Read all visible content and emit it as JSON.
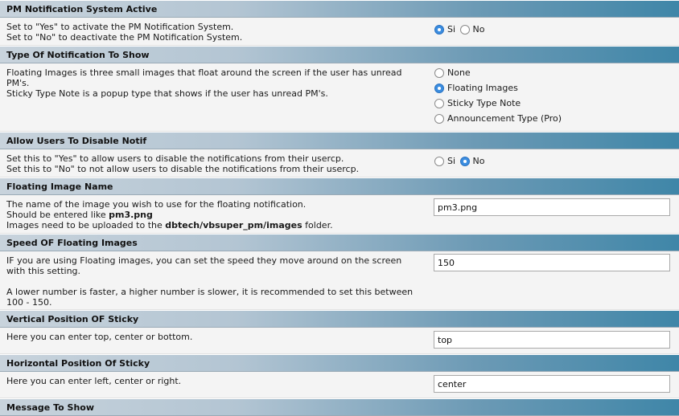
{
  "settings": [
    {
      "title": "PM Notification System Active",
      "desc": [
        "Set to \"Yes\" to activate the PM Notification System.",
        "Set to \"No\" to deactivate the PM Notification System."
      ],
      "options": [
        "Si",
        "No"
      ],
      "selected": 0
    },
    {
      "title": "Type Of Notification To Show",
      "desc": [
        "Floating Images is three small images that float around the screen if the user has unread PM's.",
        "Sticky Type Note is a popup type that shows if the user has unread PM's."
      ],
      "options": [
        "None",
        "Floating Images",
        "Sticky Type Note",
        "Announcement Type (Pro)"
      ],
      "selected": 1
    },
    {
      "title": "Allow Users To Disable Notif",
      "desc": [
        "Set this to \"Yes\" to allow users to disable the notifications from their usercp.",
        "Set this to \"No\" to not allow users to disable the notifications from their usercp."
      ],
      "options": [
        "Si",
        "No"
      ],
      "selected": 1
    },
    {
      "title": "Floating Image Name",
      "desc_line1": "The name of the image you wish to use for the floating notification.",
      "desc_line2_pre": "Should be entered like ",
      "desc_line2_bold": "pm3.png",
      "desc_line3_pre": "Images need to be uploaded to the ",
      "desc_line3_bold": "dbtech/vbsuper_pm/images",
      "desc_line3_post": " folder.",
      "value": "pm3.png"
    },
    {
      "title": "Speed OF Floating Images",
      "desc_a": "IF you are using Floating images, you can set the speed they move around on the screen with this setting.",
      "desc_b": "A lower number is faster, a higher number is slower, it is recommended to set this between 100 - 150.",
      "value": "150"
    },
    {
      "title": "Vertical Position OF Sticky",
      "desc": "Here you can enter top, center or bottom.",
      "value": "top"
    },
    {
      "title": "Horizontal Position Of Sticky",
      "desc": "Here you can enter left, center or right.",
      "value": "center"
    }
  ],
  "next_section_title_partial": "Message To Show"
}
